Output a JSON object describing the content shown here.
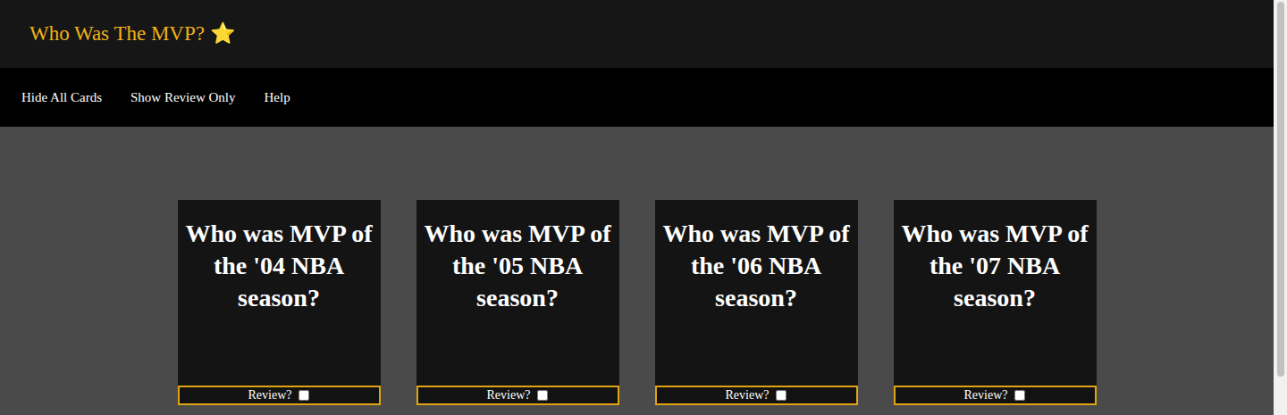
{
  "header": {
    "title": "Who Was The MVP? ⭐"
  },
  "nav": {
    "items": [
      {
        "label": "Hide All Cards"
      },
      {
        "label": "Show Review Only"
      },
      {
        "label": "Help"
      }
    ]
  },
  "cards": [
    {
      "question": "Who was MVP of the '04 NBA season?",
      "review_label": "Review?",
      "checked": false
    },
    {
      "question": "Who was MVP of the '05 NBA season?",
      "review_label": "Review?",
      "checked": false
    },
    {
      "question": "Who was MVP of the '06 NBA season?",
      "review_label": "Review?",
      "checked": false
    },
    {
      "question": "Who was MVP of the '07 NBA season?",
      "review_label": "Review?",
      "checked": false
    }
  ]
}
